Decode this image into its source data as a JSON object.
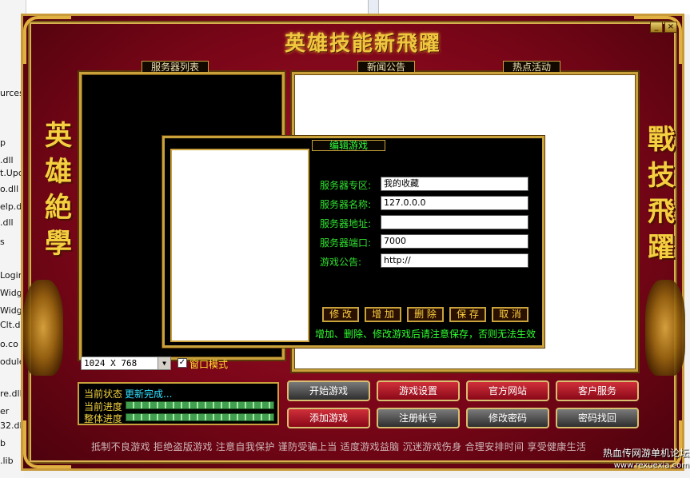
{
  "background": {
    "left_snippets": [
      "urces",
      "p",
      ".dll",
      "t.Upd",
      "o.dll",
      "elp.d",
      ".dll",
      "s",
      "Login",
      "Widg",
      "Widg",
      "Clt.dll",
      "o.co",
      "odule",
      "re.dll",
      "er",
      "32.dl",
      "b",
      ".lib"
    ]
  },
  "window": {
    "title": "英雄技能新飛躍",
    "min_icon": "_",
    "close_icon": "×"
  },
  "side_text": {
    "left": [
      "英",
      "雄",
      "絶",
      "學"
    ],
    "right": [
      "戰",
      "技",
      "飛",
      "躍"
    ]
  },
  "panels": {
    "server_list_tab": "服务器列表",
    "news_tab": "新闻公告",
    "hot_tab": "热点活动"
  },
  "resolution": {
    "value": "1024 X 768",
    "window_mode_label": "窗口模式",
    "window_mode_checked": "✓"
  },
  "status": {
    "current_state_label": "当前状态",
    "current_state_value": "更新完成...",
    "current_progress_label": "当前进度",
    "total_progress_label": "整体进度",
    "current_progress": 1.0,
    "total_progress": 1.0
  },
  "buttons": {
    "start_game": "开始游戏",
    "game_settings": "游戏设置",
    "official_site": "官方网站",
    "customer_service": "客户服务",
    "add_game": "添加游戏",
    "register": "注册帐号",
    "change_password": "修改密码",
    "recover_password": "密码找回"
  },
  "slogan": "抵制不良游戏  拒绝盗版游戏  注意自我保护  谨防受骗上当  适度游戏益脑  沉迷游戏伤身  合理安排时间  享受健康生活",
  "dialog": {
    "title": "编辑游戏",
    "fields": {
      "zone_label": "服务器专区:",
      "zone_value": "我的收藏",
      "name_label": "服务器名称:",
      "name_value": "127.0.0.0",
      "address_label": "服务器地址:",
      "address_value": "",
      "port_label": "服务器端口:",
      "port_value": "7000",
      "notice_label": "游戏公告:",
      "notice_value": "http://"
    },
    "buttons": {
      "modify": "修 改",
      "add": "增 加",
      "delete": "删 除",
      "save": "保 存",
      "cancel": "取 消"
    },
    "note": "增加、删除、修改游戏后请注意保存，否则无法生效"
  },
  "watermark": {
    "line1": "热血传网游单机论坛",
    "line2": "www.rexuexia.com"
  },
  "colors": {
    "frame_red": "#8a0818",
    "gold": "#c9a23c",
    "label_green": "#30e030",
    "status_cyan": "#30e0ff"
  }
}
